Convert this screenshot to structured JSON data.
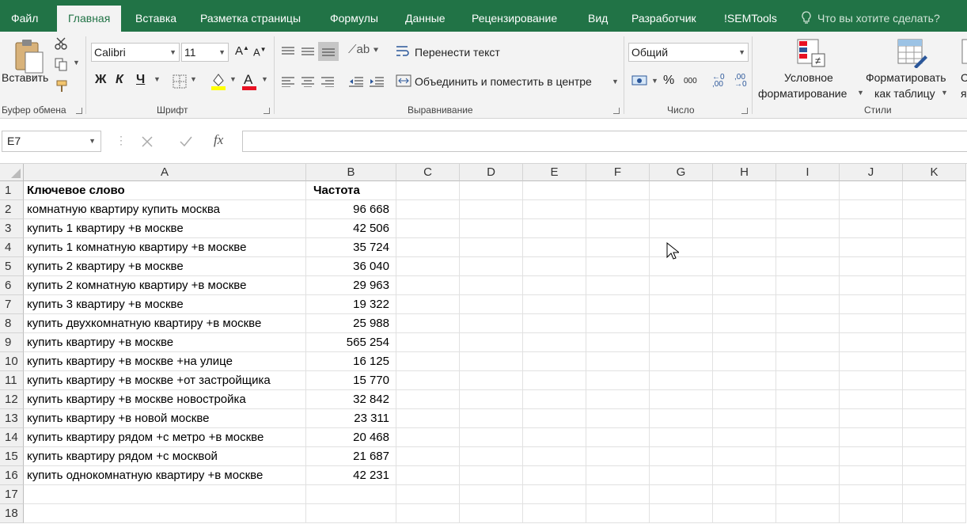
{
  "menu": {
    "tabs": [
      "Файл",
      "Главная",
      "Вставка",
      "Разметка страницы",
      "Формулы",
      "Данные",
      "Рецензирование",
      "Вид",
      "Разработчик",
      "!SEMTools"
    ],
    "search_placeholder": "Что вы хотите сделать?"
  },
  "ribbon": {
    "clipboard": {
      "paste_label": "Вставить",
      "group_label": "Буфер обмена"
    },
    "font": {
      "name": "Calibri",
      "size": "11",
      "bold": "Ж",
      "italic": "К",
      "underline": "Ч",
      "group_label": "Шрифт"
    },
    "alignment": {
      "wrap_text": "Перенести текст",
      "merge_center": "Объединить и поместить в центре",
      "group_label": "Выравнивание"
    },
    "number": {
      "format": "Общий",
      "percent": "%",
      "thousands": "000",
      "group_label": "Число"
    },
    "styles": {
      "conditional_line1": "Условное",
      "conditional_line2": "форматирование",
      "table_line1": "Форматировать",
      "table_line2": "как таблицу",
      "group_label": "Стили",
      "cell_line1": "С",
      "cell_line2": "яч"
    }
  },
  "formula_bar": {
    "name_box": "E7",
    "fx": "fx",
    "value": ""
  },
  "sheet": {
    "columns": [
      "A",
      "B",
      "C",
      "D",
      "E",
      "F",
      "G",
      "H",
      "I",
      "J",
      "K"
    ],
    "rows": [
      {
        "n": "1",
        "a": "Ключевое слово",
        "b": "Частота"
      },
      {
        "n": "2",
        "a": "комнатную квартиру купить москва",
        "b": "96 668"
      },
      {
        "n": "3",
        "a": "купить 1 квартиру +в москве",
        "b": "42 506"
      },
      {
        "n": "4",
        "a": "купить 1 комнатную квартиру +в москве",
        "b": "35 724"
      },
      {
        "n": "5",
        "a": "купить 2 квартиру +в москве",
        "b": "36 040"
      },
      {
        "n": "6",
        "a": "купить 2 комнатную квартиру +в москве",
        "b": "29 963"
      },
      {
        "n": "7",
        "a": "купить 3 квартиру +в москве",
        "b": "19 322"
      },
      {
        "n": "8",
        "a": "купить двухкомнатную квартиру +в москве",
        "b": "25 988"
      },
      {
        "n": "9",
        "a": "купить квартиру +в москве",
        "b": "565 254"
      },
      {
        "n": "10",
        "a": "купить квартиру +в москве +на улице",
        "b": "16 125"
      },
      {
        "n": "11",
        "a": "купить квартиру +в москве +от застройщика",
        "b": "15 770"
      },
      {
        "n": "12",
        "a": "купить квартиру +в москве новостройка",
        "b": "32 842"
      },
      {
        "n": "13",
        "a": "купить квартиру +в новой москве",
        "b": "23 311"
      },
      {
        "n": "14",
        "a": "купить квартиру рядом +с метро +в москве",
        "b": "20 468"
      },
      {
        "n": "15",
        "a": "купить квартиру рядом +с москвой",
        "b": "21 687"
      },
      {
        "n": "16",
        "a": "купить однокомнатную квартиру +в москве",
        "b": "42 231"
      },
      {
        "n": "17",
        "a": "",
        "b": ""
      },
      {
        "n": "18",
        "a": "",
        "b": ""
      }
    ]
  },
  "colors": {
    "accent": "#217346",
    "font_color_bar": "#e81123",
    "highlight_bar": "#ffff00"
  }
}
